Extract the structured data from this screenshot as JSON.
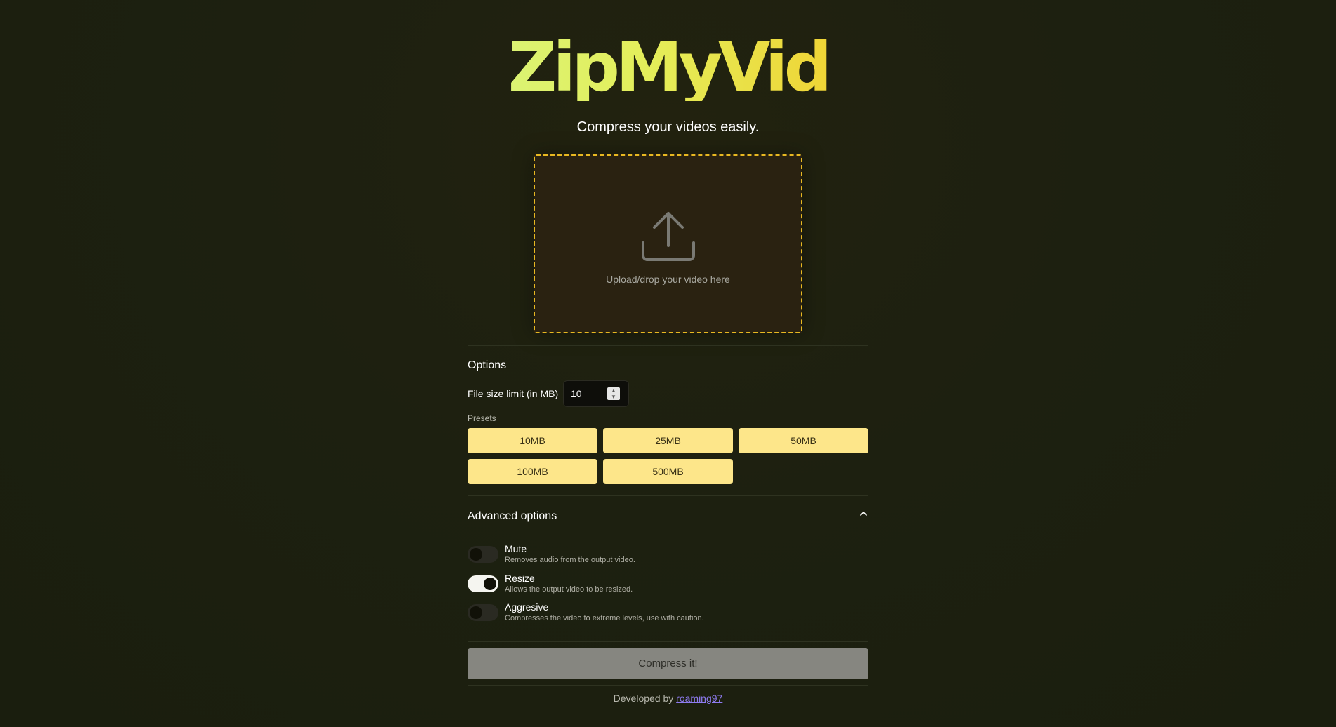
{
  "app": {
    "logo": "ZipMyVid",
    "subtitle": "Compress your videos easily."
  },
  "upload": {
    "text": "Upload/drop your video here"
  },
  "options": {
    "title": "Options",
    "file_size_label": "File size limit (in MB)",
    "file_size_value": "10",
    "presets_label": "Presets",
    "presets": [
      "10MB",
      "25MB",
      "50MB",
      "100MB",
      "500MB"
    ]
  },
  "advanced": {
    "title": "Advanced options",
    "toggles": [
      {
        "label": "Mute",
        "description": "Removes audio from the output video.",
        "enabled": false
      },
      {
        "label": "Resize",
        "description": "Allows the output video to be resized.",
        "enabled": true
      },
      {
        "label": "Aggresive",
        "description": "Compresses the video to extreme levels, use with caution.",
        "enabled": false
      }
    ]
  },
  "actions": {
    "compress_label": "Compress it!"
  },
  "footer": {
    "prefix": "Developed by",
    "author": "roaming97"
  },
  "colors": {
    "accent": "#fde68a",
    "dropzone_border": "#e8b821",
    "link": "#8e7bf0"
  }
}
